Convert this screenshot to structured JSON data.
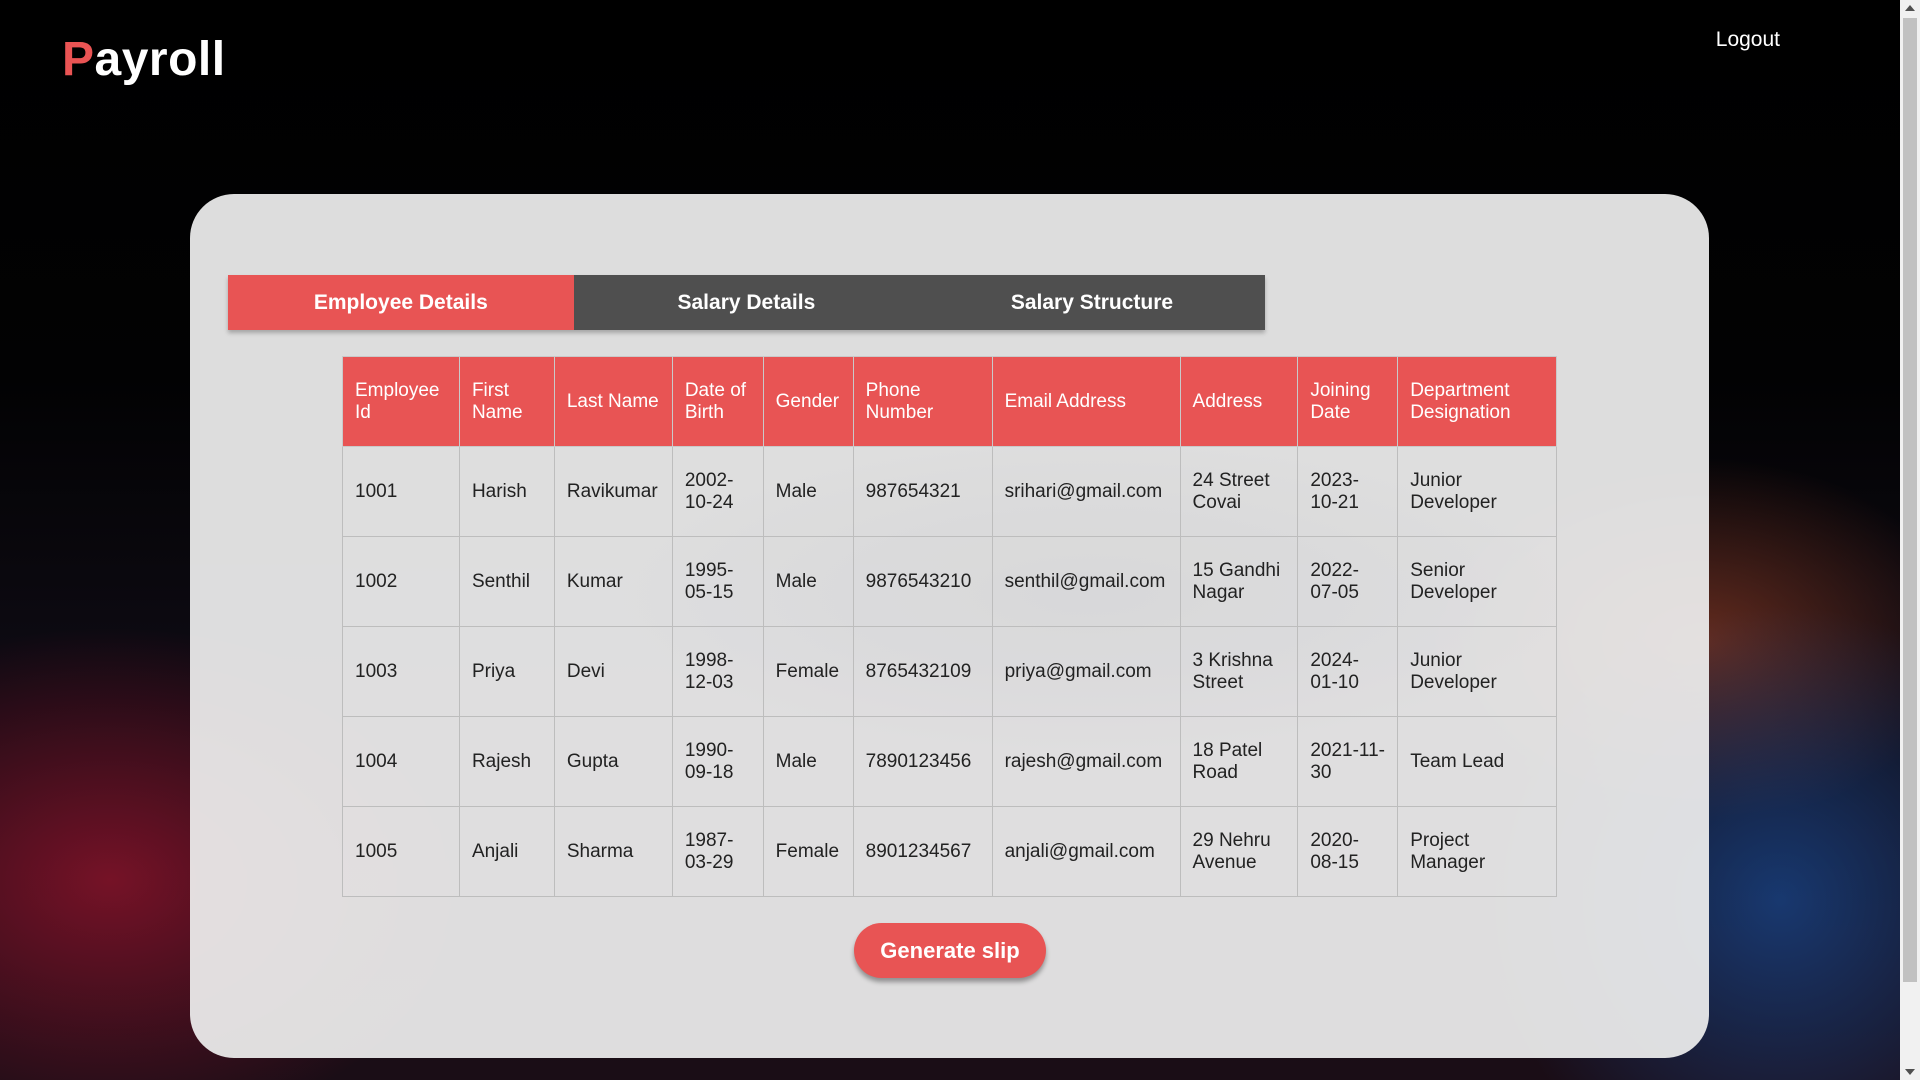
{
  "header": {
    "logo_first": "P",
    "logo_rest": "ayroll",
    "logout_label": "Logout"
  },
  "tabs": [
    {
      "label": "Employee Details",
      "active": true
    },
    {
      "label": "Salary Details",
      "active": false
    },
    {
      "label": "Salary Structure",
      "active": false
    }
  ],
  "table": {
    "columns": [
      "Employee Id",
      "First Name",
      "Last Name",
      "Date of Birth",
      "Gender",
      "Phone Number",
      "Email Address",
      "Address",
      "Joining Date",
      "Department Designation"
    ],
    "rows": [
      [
        "1001",
        "Harish",
        "Ravikumar",
        "2002-10-24",
        "Male",
        "987654321",
        "srihari@gmail.com",
        "24 Street Covai",
        "2023-10-21",
        "Junior Developer"
      ],
      [
        "1002",
        "Senthil",
        "Kumar",
        "1995-05-15",
        "Male",
        "9876543210",
        "senthil@gmail.com",
        "15 Gandhi Nagar",
        "2022-07-05",
        "Senior Developer"
      ],
      [
        "1003",
        "Priya",
        "Devi",
        "1998-12-03",
        "Female",
        "8765432109",
        "priya@gmail.com",
        "3 Krishna Street",
        "2024-01-10",
        "Junior Developer"
      ],
      [
        "1004",
        "Rajesh",
        "Gupta",
        "1990-09-18",
        "Male",
        "7890123456",
        "rajesh@gmail.com",
        "18 Patel Road",
        "2021-11-30",
        "Team Lead"
      ],
      [
        "1005",
        "Anjali",
        "Sharma",
        "1987-03-29",
        "Female",
        "8901234567",
        "anjali@gmail.com",
        "29 Nehru Avenue",
        "2020-08-15",
        "Project Manager"
      ]
    ]
  },
  "actions": {
    "generate_label": "Generate slip"
  },
  "colors": {
    "accent": "#e85454",
    "tab_inactive": "#4f4f4f",
    "background": "#000000"
  }
}
